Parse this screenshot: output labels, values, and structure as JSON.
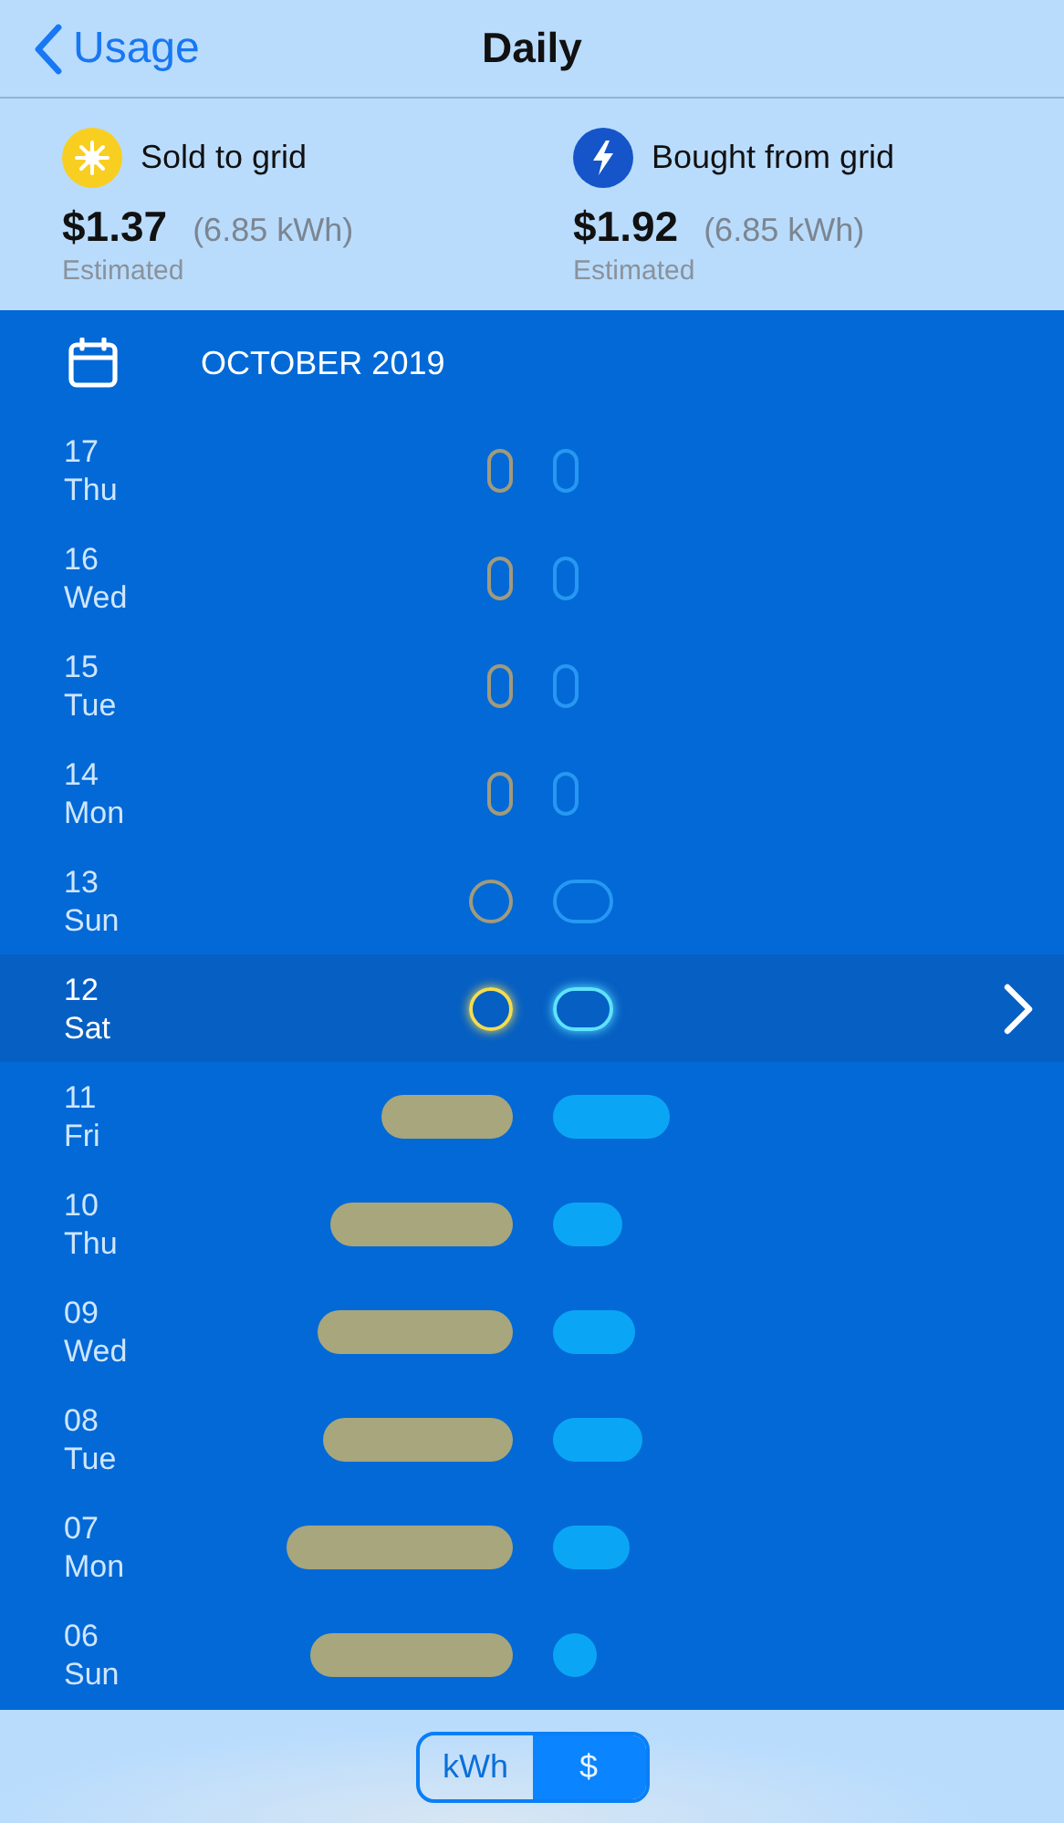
{
  "nav": {
    "back": "Usage",
    "title": "Daily"
  },
  "summary": [
    {
      "kind": "sold",
      "label": "Sold to grid",
      "amount": "$1.37",
      "energy": "(6.85 kWh)",
      "note": "Estimated"
    },
    {
      "kind": "bought",
      "label": "Bought from grid",
      "amount": "$1.92",
      "energy": "(6.85 kWh)",
      "note": "Estimated"
    }
  ],
  "month": "OCTOBER 2019",
  "days": [
    {
      "day": "17",
      "weekday": "Thu",
      "selected": false,
      "sold": {
        "kind": "outline"
      },
      "bought": {
        "kind": "outline"
      }
    },
    {
      "day": "16",
      "weekday": "Wed",
      "selected": false,
      "sold": {
        "kind": "outline"
      },
      "bought": {
        "kind": "outline"
      }
    },
    {
      "day": "15",
      "weekday": "Tue",
      "selected": false,
      "sold": {
        "kind": "outline"
      },
      "bought": {
        "kind": "outline"
      }
    },
    {
      "day": "14",
      "weekday": "Mon",
      "selected": false,
      "sold": {
        "kind": "outline"
      },
      "bought": {
        "kind": "outline"
      }
    },
    {
      "day": "13",
      "weekday": "Sun",
      "selected": false,
      "sold": {
        "kind": "outline"
      },
      "bought": {
        "kind": "outline"
      }
    },
    {
      "day": "12",
      "weekday": "Sat",
      "selected": true,
      "sold": {
        "kind": "outline"
      },
      "bought": {
        "kind": "outline"
      }
    },
    {
      "day": "11",
      "weekday": "Fri",
      "selected": false,
      "sold": {
        "kind": "filled"
      },
      "bought": {
        "kind": "filled"
      }
    },
    {
      "day": "10",
      "weekday": "Thu",
      "selected": false,
      "sold": {
        "kind": "filled"
      },
      "bought": {
        "kind": "filled"
      }
    },
    {
      "day": "09",
      "weekday": "Wed",
      "selected": false,
      "sold": {
        "kind": "filled"
      },
      "bought": {
        "kind": "filled"
      }
    },
    {
      "day": "08",
      "weekday": "Tue",
      "selected": false,
      "sold": {
        "kind": "filled"
      },
      "bought": {
        "kind": "filled"
      }
    },
    {
      "day": "07",
      "weekday": "Mon",
      "selected": false,
      "sold": {
        "kind": "filled"
      },
      "bought": {
        "kind": "filled"
      }
    },
    {
      "day": "06",
      "weekday": "Sun",
      "selected": false,
      "sold": {
        "kind": "filled"
      },
      "bought": {
        "kind": "filled"
      }
    }
  ],
  "units": [
    {
      "label": "kWh",
      "selected": false
    },
    {
      "label": "$",
      "selected": true
    }
  ]
}
